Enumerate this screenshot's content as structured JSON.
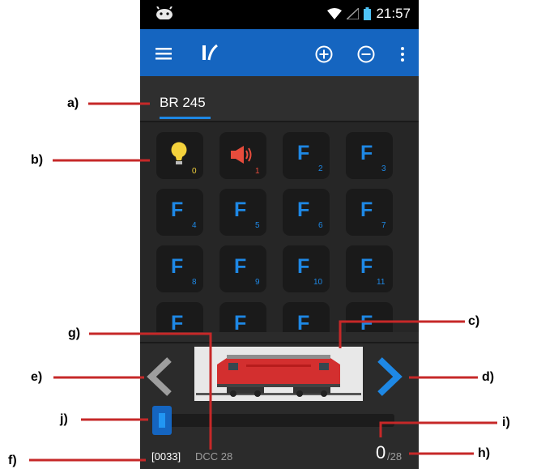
{
  "status_bar": {
    "time": "21:57"
  },
  "app_bar": {
    "icons": [
      "menu-icon",
      "app-logo-icon",
      "plus-circle-icon",
      "minus-circle-icon",
      "overflow-icon"
    ]
  },
  "tab": {
    "label": "BR 245"
  },
  "functions": [
    {
      "icon": "bulb",
      "num": "0"
    },
    {
      "icon": "speaker",
      "num": "1"
    },
    {
      "letter": "F",
      "num": "2"
    },
    {
      "letter": "F",
      "num": "3"
    },
    {
      "letter": "F",
      "num": "4"
    },
    {
      "letter": "F",
      "num": "5"
    },
    {
      "letter": "F",
      "num": "6"
    },
    {
      "letter": "F",
      "num": "7"
    },
    {
      "letter": "F",
      "num": "8"
    },
    {
      "letter": "F",
      "num": "9"
    },
    {
      "letter": "F",
      "num": "10"
    },
    {
      "letter": "F",
      "num": "11"
    },
    {
      "letter": "F",
      "num": ""
    },
    {
      "letter": "F",
      "num": ""
    },
    {
      "letter": "F",
      "num": ""
    },
    {
      "letter": "F",
      "num": ""
    }
  ],
  "footer": {
    "address": "[0033]",
    "protocol": "DCC 28",
    "speed_value": "0",
    "speed_max": "/28"
  },
  "callouts": {
    "a": "a)",
    "b": "b)",
    "c": "c)",
    "d": "d)",
    "e": "e)",
    "f": "f)",
    "g": "g)",
    "h": "h)",
    "i": "i)",
    "j": "j)"
  },
  "colors": {
    "accent": "#1565c0",
    "callout_line": "#c62828",
    "bulb": "#f4d23c",
    "speaker": "#e74c3c"
  }
}
